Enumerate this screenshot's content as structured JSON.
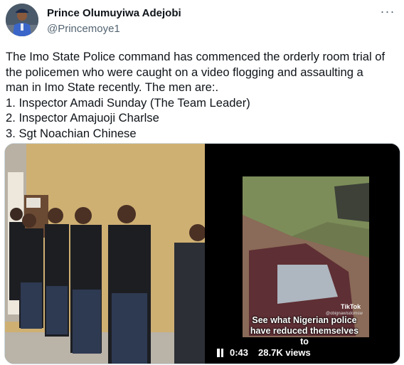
{
  "author": {
    "display_name": "Prince Olumuyiwa Adejobi",
    "handle": "@Princemoye1",
    "avatar_icon": "avatar-police-officer"
  },
  "more_icon": "more-options-icon",
  "tweet": {
    "lines": [
      "The Imo State Police command has commenced the orderly room trial of",
      "the policemen who were caught on a video flogging and assaulting a",
      "man in Imo State recently.  The men are:.",
      "1. Inspector Amadi Sunday (The Team Leader)",
      "2. Inspector Amajuoji Charlse",
      "3. Sgt Noachian Chinese"
    ]
  },
  "video": {
    "caption_lines": [
      "See what Nigerian police",
      "have reduced themselves",
      "to"
    ],
    "tiktok_label": "TikTok",
    "tiktok_user": "@obignawisdomsw",
    "time": "0:43",
    "views": "28.7K views",
    "play_state_icon": "pause-icon"
  }
}
